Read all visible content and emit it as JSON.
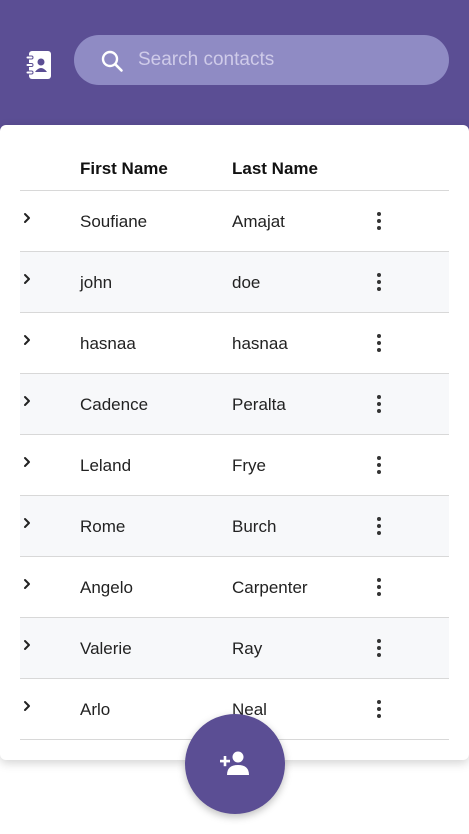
{
  "search": {
    "placeholder": "Search contacts"
  },
  "table": {
    "headers": {
      "first_name": "First Name",
      "last_name": "Last Name"
    },
    "rows": [
      {
        "first": "Soufiane",
        "last": "Amajat"
      },
      {
        "first": "john",
        "last": "doe"
      },
      {
        "first": "hasnaa",
        "last": "hasnaa"
      },
      {
        "first": "Cadence",
        "last": "Peralta"
      },
      {
        "first": "Leland",
        "last": "Frye"
      },
      {
        "first": "Rome",
        "last": "Burch"
      },
      {
        "first": "Angelo",
        "last": "Carpenter"
      },
      {
        "first": "Valerie",
        "last": "Ray"
      },
      {
        "first": "Arlo",
        "last": "Neal"
      }
    ]
  },
  "icons": {
    "app": "contacts-book-icon",
    "search": "search-icon",
    "expand": "chevron-right-icon",
    "row_menu": "more-vert-icon",
    "fab": "person-add-icon"
  },
  "colors": {
    "primary": "#5b4e94",
    "search_bg": "#8f8bc4",
    "row_alt": "#f7f8fa",
    "divider": "#d8d8d8"
  }
}
